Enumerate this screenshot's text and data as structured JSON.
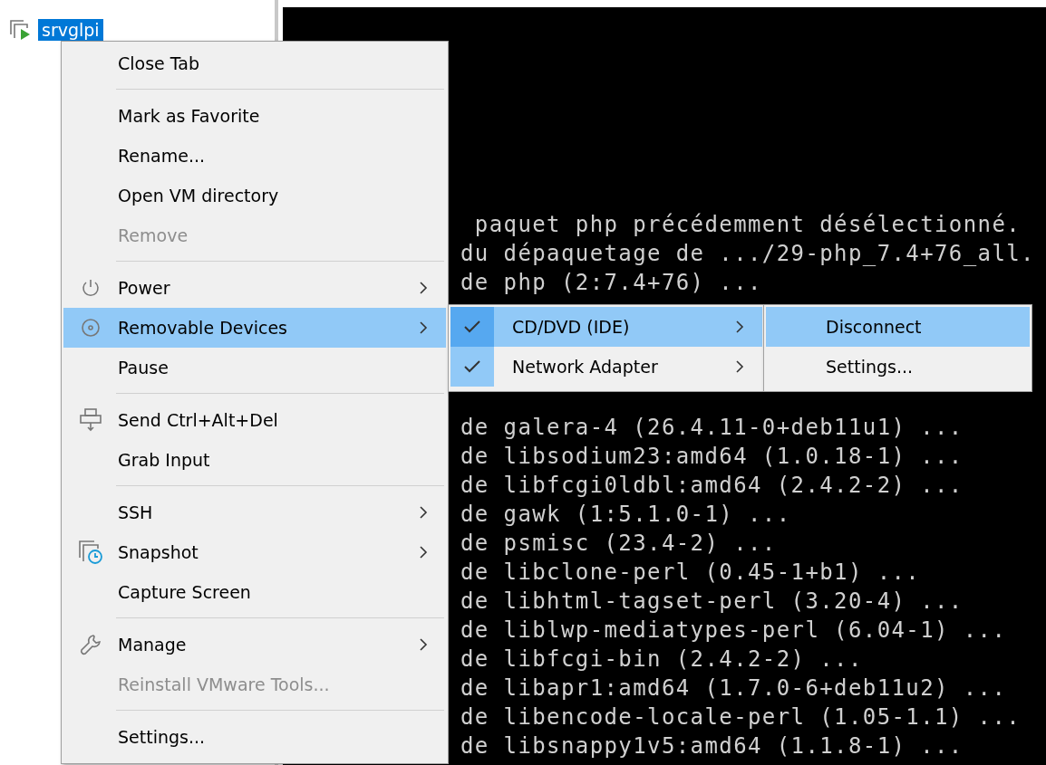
{
  "library": {
    "items": [
      {
        "label": "srvglpi",
        "selected": true
      }
    ]
  },
  "terminal": {
    "line_groups": [
      [
        " paquet php précédemment désélectionné.",
        "du dépaquetage de .../29-php_7.4+76_all.",
        "de php (2:7.4+76) ..."
      ],
      [
        "de galera-4 (26.4.11-0+deb11u1) ...",
        "de libsodium23:amd64 (1.0.18-1) ...",
        "de libfcgi0ldbl:amd64 (2.4.2-2) ...",
        "de gawk (1:5.1.0-1) ...",
        "de psmisc (23.4-2) ...",
        "de libclone-perl (0.45-1+b1) ...",
        "de libhtml-tagset-perl (3.20-4) ...",
        "de liblwp-mediatypes-perl (6.04-1) ...",
        "de libfcgi-bin (2.4.2-2) ...",
        "de libapr1:amd64 (1.7.0-6+deb11u2) ...",
        "de libencode-locale-perl (1.05-1.1) ...",
        "de libsnappy1v5:amd64 (1.1.8-1) ..."
      ]
    ]
  },
  "context_menu": {
    "items": [
      {
        "kind": "item",
        "label": "Close Tab",
        "disabled": false,
        "selected": false,
        "submenu": false
      },
      {
        "kind": "separator"
      },
      {
        "kind": "item",
        "label": "Mark as Favorite",
        "disabled": false,
        "selected": false,
        "submenu": false
      },
      {
        "kind": "item",
        "label": "Rename...",
        "disabled": false,
        "selected": false,
        "submenu": false
      },
      {
        "kind": "item",
        "label": "Open VM directory",
        "disabled": false,
        "selected": false,
        "submenu": false
      },
      {
        "kind": "item",
        "label": "Remove",
        "disabled": true,
        "selected": false,
        "submenu": false
      },
      {
        "kind": "separator"
      },
      {
        "kind": "item",
        "label": "Power",
        "disabled": false,
        "selected": false,
        "submenu": true
      },
      {
        "kind": "item",
        "label": "Removable Devices",
        "disabled": false,
        "selected": true,
        "submenu": true
      },
      {
        "kind": "item",
        "label": "Pause",
        "disabled": false,
        "selected": false,
        "submenu": false
      },
      {
        "kind": "separator"
      },
      {
        "kind": "item",
        "label": "Send Ctrl+Alt+Del",
        "disabled": false,
        "selected": false,
        "submenu": false
      },
      {
        "kind": "item",
        "label": "Grab Input",
        "disabled": false,
        "selected": false,
        "submenu": false
      },
      {
        "kind": "separator"
      },
      {
        "kind": "item",
        "label": "SSH",
        "disabled": false,
        "selected": false,
        "submenu": true
      },
      {
        "kind": "item",
        "label": "Snapshot",
        "disabled": false,
        "selected": false,
        "submenu": true
      },
      {
        "kind": "item",
        "label": "Capture Screen",
        "disabled": false,
        "selected": false,
        "submenu": false
      },
      {
        "kind": "separator"
      },
      {
        "kind": "item",
        "label": "Manage",
        "disabled": false,
        "selected": false,
        "submenu": true
      },
      {
        "kind": "item",
        "label": "Reinstall VMware Tools...",
        "disabled": true,
        "selected": false,
        "submenu": false
      },
      {
        "kind": "separator"
      },
      {
        "kind": "item",
        "label": "Settings...",
        "disabled": false,
        "selected": false,
        "submenu": false
      }
    ]
  },
  "devices_menu": {
    "items": [
      {
        "label": "CD/DVD (IDE)",
        "checked": true,
        "selected": true,
        "submenu": true
      },
      {
        "label": "Network Adapter",
        "checked": true,
        "selected": false,
        "submenu": true
      }
    ]
  },
  "device_actions_menu": {
    "items": [
      {
        "label": "Disconnect",
        "selected": true
      },
      {
        "label": "Settings...",
        "selected": false
      }
    ]
  }
}
